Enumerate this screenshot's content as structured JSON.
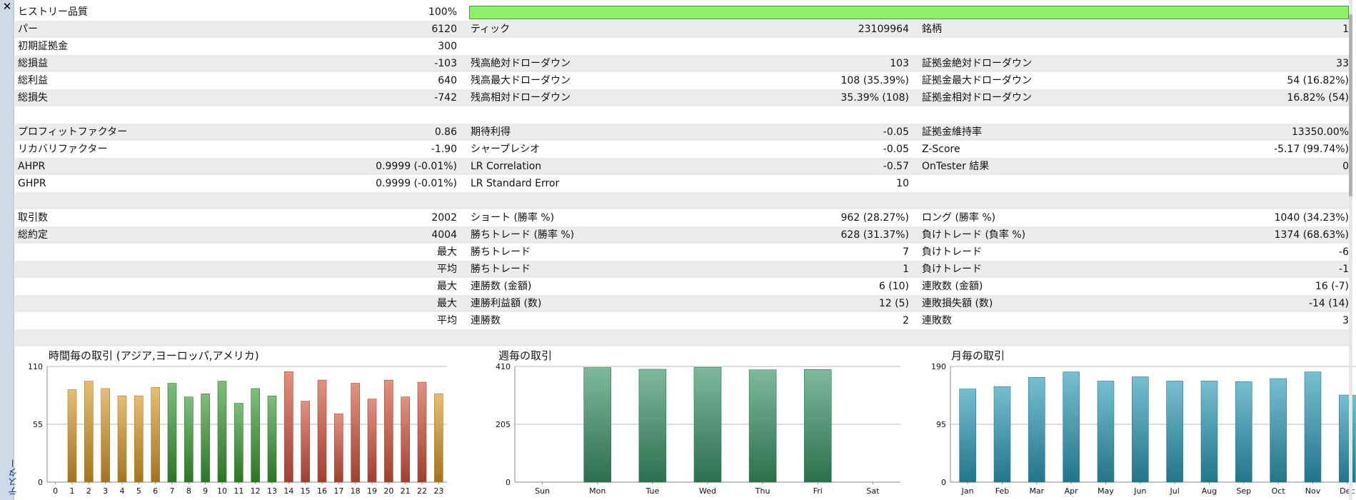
{
  "side_title": "テスター",
  "quality": {
    "label": "ヒストリー品質",
    "value": "100%",
    "fill": 1.0
  },
  "rows": [
    {
      "shade": true,
      "cells": [
        "パー",
        "6120",
        "ティック",
        "23109964",
        "銘柄",
        "1"
      ]
    },
    {
      "shade": false,
      "cells": [
        "初期証拠金",
        "300",
        "",
        "",
        "",
        ""
      ]
    },
    {
      "shade": true,
      "cells": [
        "総損益",
        "-103",
        "残高絶対ドローダウン",
        "103",
        "証拠金絶対ドローダウン",
        "33"
      ]
    },
    {
      "shade": false,
      "cells": [
        "総利益",
        "640",
        "残高最大ドローダウン",
        "108 (35.39%)",
        "証拠金最大ドローダウン",
        "54 (16.82%)"
      ]
    },
    {
      "shade": true,
      "cells": [
        "総損失",
        "-742",
        "残高相対ドローダウン",
        "35.39% (108)",
        "証拠金相対ドローダウン",
        "16.82% (54)"
      ]
    },
    {
      "shade": false,
      "cells": [
        "",
        "",
        "",
        "",
        "",
        ""
      ]
    },
    {
      "shade": true,
      "cells": [
        "プロフィットファクター",
        "0.86",
        "期待利得",
        "-0.05",
        "証拠金維持率",
        "13350.00%"
      ]
    },
    {
      "shade": false,
      "cells": [
        "リカバリファクター",
        "-1.90",
        "シャープレシオ",
        "-0.05",
        "Z-Score",
        "-5.17 (99.74%)"
      ]
    },
    {
      "shade": true,
      "cells": [
        "AHPR",
        "0.9999 (-0.01%)",
        "LR Correlation",
        "-0.57",
        "OnTester 結果",
        "0"
      ]
    },
    {
      "shade": false,
      "cells": [
        "GHPR",
        "0.9999 (-0.01%)",
        "LR Standard Error",
        "10",
        "",
        ""
      ]
    },
    {
      "shade": true,
      "cells": [
        "",
        "",
        "",
        "",
        "",
        ""
      ]
    },
    {
      "shade": false,
      "cells": [
        "取引数",
        "2002",
        "ショート (勝率 %)",
        "962 (28.27%)",
        "ロング (勝率 %)",
        "1040 (34.23%)"
      ]
    },
    {
      "shade": true,
      "cells": [
        "総約定",
        "4004",
        "勝ちトレード (勝率 %)",
        "628 (31.37%)",
        "負けトレード (負率 %)",
        "1374 (68.63%)"
      ]
    },
    {
      "shade": false,
      "cells": [
        "",
        "最大",
        "勝ちトレード",
        "7",
        "負けトレード",
        "-6"
      ]
    },
    {
      "shade": true,
      "cells": [
        "",
        "平均",
        "勝ちトレード",
        "1",
        "負けトレード",
        "-1"
      ]
    },
    {
      "shade": false,
      "cells": [
        "",
        "最大",
        "連勝数 (金額)",
        "6 (10)",
        "連敗数 (金額)",
        "16 (-7)"
      ]
    },
    {
      "shade": true,
      "cells": [
        "",
        "最大",
        "連勝利益額 (数)",
        "12 (5)",
        "連敗損失額 (数)",
        "-14 (14)"
      ]
    },
    {
      "shade": false,
      "cells": [
        "",
        "平均",
        "連勝数",
        "2",
        "連敗数",
        "3"
      ]
    },
    {
      "shade": true,
      "cells": [
        "",
        "",
        "",
        "",
        "",
        ""
      ]
    }
  ],
  "chart_data": [
    {
      "type": "bar",
      "title": "時間毎の取引 (アジア,ヨーロッパ,アメリカ)",
      "categories": [
        "0",
        "1",
        "2",
        "3",
        "4",
        "5",
        "6",
        "7",
        "8",
        "9",
        "10",
        "11",
        "12",
        "13",
        "14",
        "15",
        "16",
        "17",
        "18",
        "19",
        "20",
        "21",
        "22",
        "23"
      ],
      "values": [
        0,
        88,
        96,
        89,
        82,
        82,
        90,
        94,
        81,
        84,
        96,
        75,
        89,
        82,
        105,
        77,
        97,
        65,
        94,
        79,
        97,
        81,
        95,
        84
      ],
      "bar_colors": [
        "#d89a2c",
        "#d89a2c",
        "#d89a2c",
        "#d89a2c",
        "#d89a2c",
        "#d89a2c",
        "#d89a2c",
        "#3c9a35",
        "#3c9a35",
        "#3c9a35",
        "#3c9a35",
        "#3c9a35",
        "#3c9a35",
        "#3c9a35",
        "#d2553f",
        "#d2553f",
        "#d2553f",
        "#d2553f",
        "#d2553f",
        "#d2553f",
        "#d2553f",
        "#d2553f",
        "#d2553f",
        "#d89a2c"
      ],
      "yticks": [
        "0",
        "55",
        "110"
      ],
      "ylim": [
        0,
        110
      ],
      "grid": true
    },
    {
      "type": "bar",
      "title": "週毎の取引",
      "categories": [
        "Sun",
        "Mon",
        "Tue",
        "Wed",
        "Thu",
        "Fri",
        "Sat"
      ],
      "values": [
        0,
        406,
        400,
        407,
        398,
        399,
        0
      ],
      "bar_colors": [
        "#3a9466",
        "#3a9466",
        "#3a9466",
        "#3a9466",
        "#3a9466",
        "#3a9466",
        "#3a9466"
      ],
      "yticks": [
        "0",
        "205",
        "410"
      ],
      "ylim": [
        0,
        410
      ],
      "grid": true
    },
    {
      "type": "bar",
      "title": "月毎の取引",
      "categories": [
        "Jan",
        "Feb",
        "Mar",
        "Apr",
        "May",
        "Jun",
        "Jul",
        "Aug",
        "Sep",
        "Oct",
        "Nov",
        "Dec"
      ],
      "values": [
        153,
        157,
        172,
        181,
        166,
        173,
        166,
        166,
        165,
        170,
        181,
        143
      ],
      "bar_colors": [
        "#2e9bb8",
        "#2e9bb8",
        "#2e9bb8",
        "#2e9bb8",
        "#2e9bb8",
        "#2e9bb8",
        "#2e9bb8",
        "#2e9bb8",
        "#2e9bb8",
        "#2e9bb8",
        "#2e9bb8",
        "#2e9bb8"
      ],
      "yticks": [
        "0",
        "95",
        "190"
      ],
      "ylim": [
        0,
        190
      ],
      "grid": true
    }
  ]
}
